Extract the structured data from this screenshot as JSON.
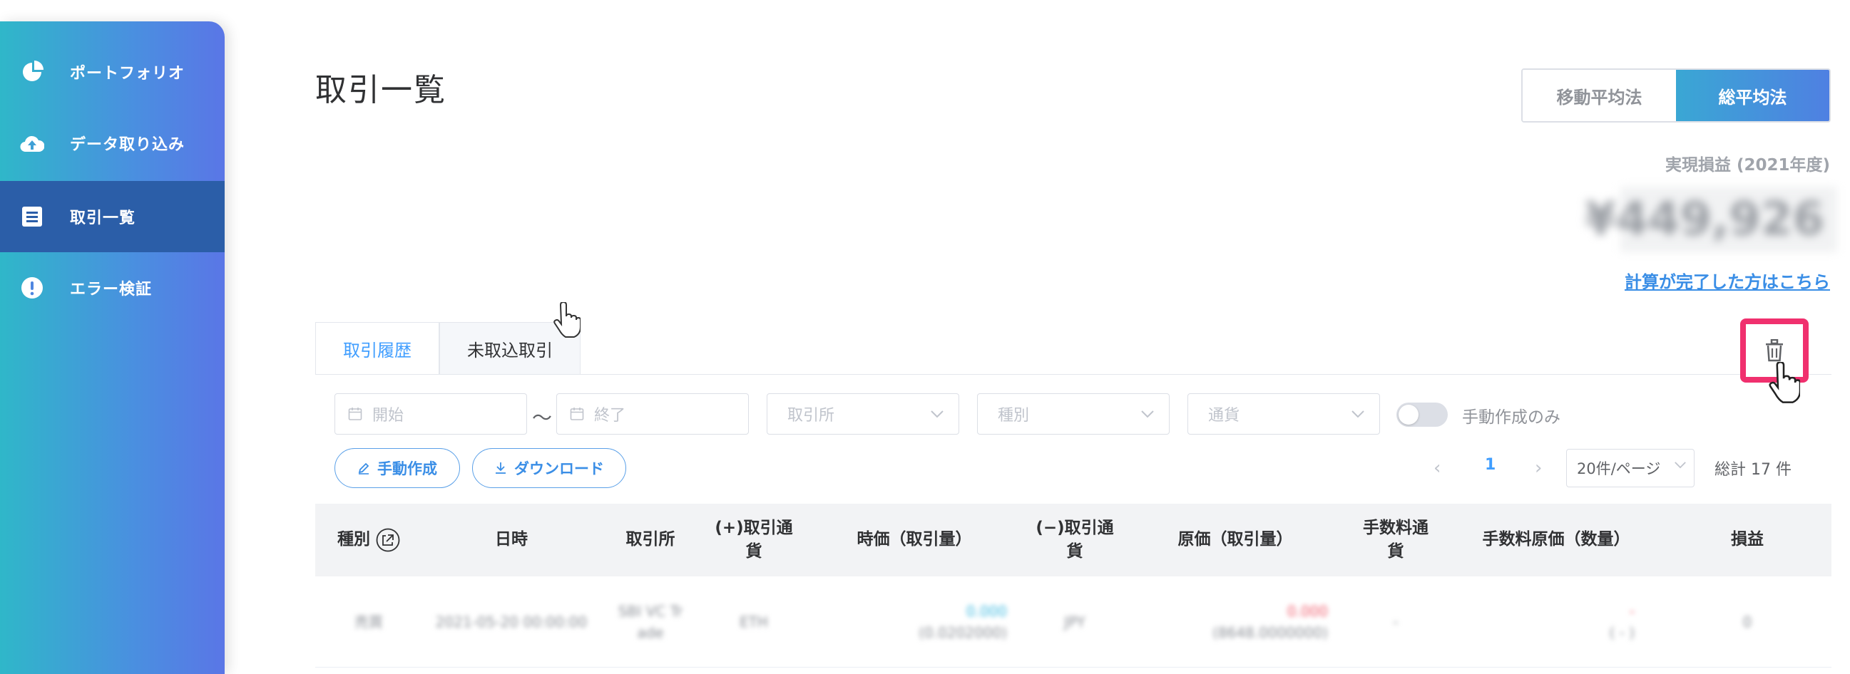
{
  "sidebar": {
    "items": [
      {
        "label": "ポートフォリオ",
        "icon": "pie-chart-icon"
      },
      {
        "label": "データ取り込み",
        "icon": "cloud-upload-icon"
      },
      {
        "label": "取引一覧",
        "icon": "list-icon",
        "active": true
      },
      {
        "label": "エラー検証",
        "icon": "alert-icon"
      }
    ]
  },
  "header": {
    "title": "取引一覧",
    "method_options": [
      "移動平均法",
      "総平均法"
    ],
    "method_selected": "総平均法",
    "pnl_label": "実現損益 (2021年度)",
    "pnl_value": "¥449,926",
    "calc_link": "計算が完了した方はこちら"
  },
  "tabs": [
    {
      "label": "取引履歴",
      "active": true
    },
    {
      "label": "未取込取引",
      "active": false
    }
  ],
  "filters": {
    "start_placeholder": "開始",
    "range_separator": "〜",
    "end_placeholder": "終了",
    "exchange_placeholder": "取引所",
    "type_placeholder": "種別",
    "currency_placeholder": "通貨",
    "manual_only_label": "手動作成のみ"
  },
  "actions": {
    "manual_create": "手動作成",
    "download": "ダウンロード"
  },
  "pagination": {
    "current": "1",
    "page_size": "20件/ページ",
    "total": "総計 17 件"
  },
  "table": {
    "headers": [
      "種別",
      "日時",
      "取引所",
      "(+)取引通\n貨",
      "時価（取引量）",
      "(−)取引通\n貨",
      "原価（取引量）",
      "手数料通\n貨",
      "手数料原価（数量）",
      "損益"
    ],
    "rows": [
      {
        "type": "売買",
        "datetime": "2021-05-20 00:00:00",
        "exchange": "SBI VC Tr\nade",
        "plus_currency": "ETH",
        "market_value": "0.000",
        "market_qty": "(0.0202000)",
        "minus_currency": "JPY",
        "cost_value": "0.000",
        "cost_qty": "(8648.0000000)",
        "fee_currency": "-",
        "fee_cost": "-",
        "fee_qty": "( - )",
        "pnl": "0"
      }
    ]
  },
  "colors": {
    "accent": "#409eff",
    "highlight_box": "#f0306e",
    "sidebar_active": "#2b5ea8"
  }
}
